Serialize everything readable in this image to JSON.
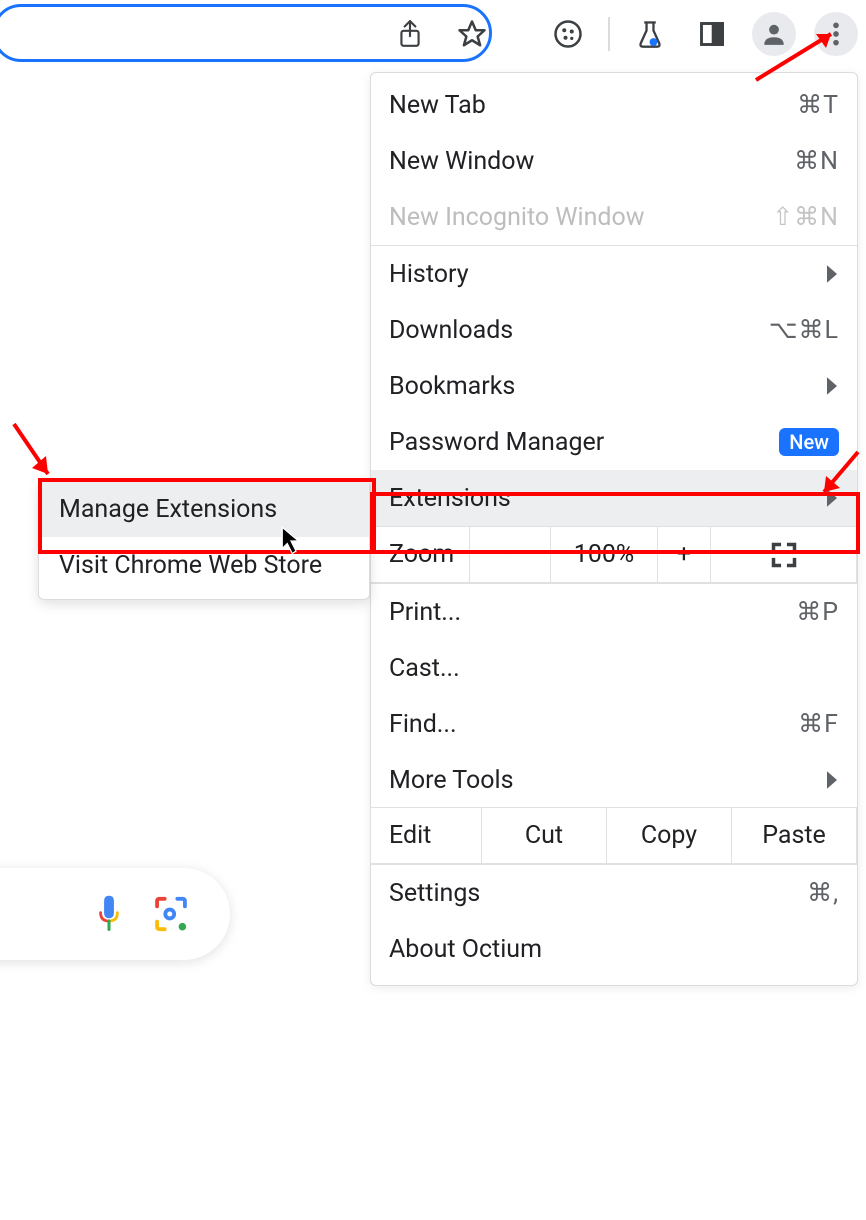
{
  "toolbar": {
    "icons": [
      "share",
      "star",
      "cookie",
      "flask",
      "panel",
      "profile",
      "more"
    ]
  },
  "menu": {
    "new_tab": {
      "label": "New Tab",
      "shortcut": "⌘T"
    },
    "new_window": {
      "label": "New Window",
      "shortcut": "⌘N"
    },
    "new_incognito": {
      "label": "New Incognito Window",
      "shortcut": "⇧⌘N"
    },
    "history": {
      "label": "History"
    },
    "downloads": {
      "label": "Downloads",
      "shortcut": "⌥⌘L"
    },
    "bookmarks": {
      "label": "Bookmarks"
    },
    "password_manager": {
      "label": "Password Manager",
      "badge": "New"
    },
    "extensions": {
      "label": "Extensions"
    },
    "zoom": {
      "label": "Zoom",
      "minus": "−",
      "value": "100%",
      "plus": "+"
    },
    "print": {
      "label": "Print...",
      "shortcut": "⌘P"
    },
    "cast": {
      "label": "Cast..."
    },
    "find": {
      "label": "Find...",
      "shortcut": "⌘F"
    },
    "more_tools": {
      "label": "More Tools"
    },
    "edit": {
      "label": "Edit",
      "cut": "Cut",
      "copy": "Copy",
      "paste": "Paste"
    },
    "settings": {
      "label": "Settings",
      "shortcut": "⌘,"
    },
    "about": {
      "label": "About Octium"
    }
  },
  "submenu": {
    "manage": "Manage Extensions",
    "store": "Visit Chrome Web Store"
  }
}
